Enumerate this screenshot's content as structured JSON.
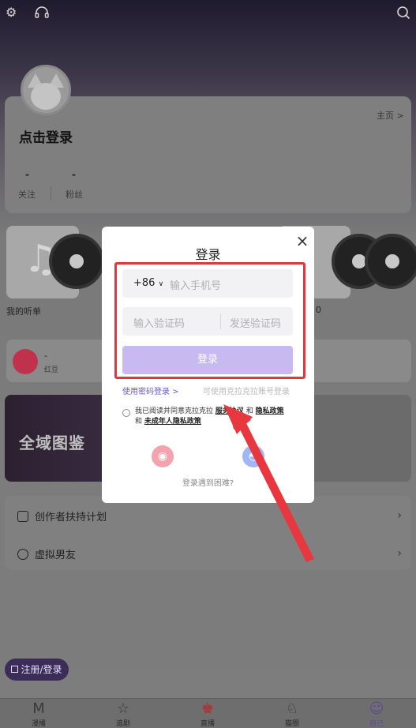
{
  "profile": {
    "title": "点击登录",
    "home_link": "主页 >",
    "follow_count": "-",
    "follow_label": "关注",
    "fans_count": "-",
    "fans_label": "粉丝"
  },
  "playlist": {
    "label": "我的听单",
    "second_label": "0"
  },
  "mini_card": {
    "name": "-",
    "sub": "红豆"
  },
  "banner": {
    "text": "全域图鉴"
  },
  "menu": [
    {
      "label": "创作者扶持计划"
    },
    {
      "label": "虚拟男友"
    }
  ],
  "register_button": "注册/登录",
  "tabs": [
    {
      "label": "漫播",
      "icon": "M"
    },
    {
      "label": "追剧",
      "icon": "☆"
    },
    {
      "label": "直播",
      "icon": "♚"
    },
    {
      "label": "猫圈",
      "icon": "♘"
    },
    {
      "label": "自己",
      "icon": "☺"
    }
  ],
  "modal": {
    "title": "登录",
    "close": "×",
    "country_code": "+86",
    "phone_placeholder": "输入手机号",
    "code_placeholder": "输入验证码",
    "send_code": "发送验证码",
    "login_button": "登录",
    "password_login": "使用密码登录 >",
    "account_login": "可使用克拉克拉账号登录",
    "agree_prefix": "我已阅读并同意克拉克拉",
    "agree_service": "服务协议",
    "agree_and1": "和",
    "agree_privacy": "隐私政策",
    "agree_and2": "和",
    "agree_minor": "未成年人隐私政策",
    "trouble": "登录遇到困难?"
  },
  "colors": {
    "accent": "#c9b9f1",
    "link": "#6a58c8",
    "annotation": "#e0373f"
  }
}
